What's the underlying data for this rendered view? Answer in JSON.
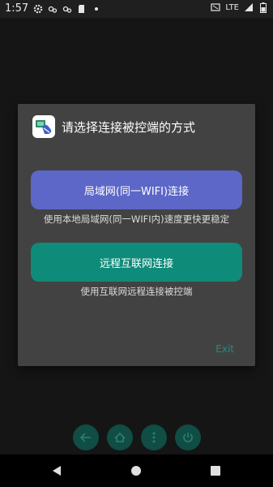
{
  "status_bar": {
    "time": "1:57",
    "network": "LTE",
    "icons": [
      "gear-icon",
      "sync-icon",
      "sync-icon",
      "sd-card-icon",
      "dot-icon",
      "cast-icon",
      "signal-icon",
      "battery-icon"
    ]
  },
  "dialog": {
    "title": "请选择连接被控端的方式",
    "app_icon": "remote-control-app-icon",
    "lan_button_label": "局域网(同一WIFI)连接",
    "lan_hint": "使用本地局域网(同一WIFI内)速度更快更稳定",
    "remote_button_label": "远程互联网连接",
    "remote_hint": "使用互联网远程连接被控端",
    "exit_label": "Exit"
  },
  "bottom_controls": [
    "back-arrow-icon",
    "home-icon",
    "more-vert-icon",
    "power-icon"
  ],
  "navbar": [
    "nav-back-icon",
    "nav-home-icon",
    "nav-recent-icon"
  ],
  "colors": {
    "lan_button": "#5c67c7",
    "remote_button": "#0f8b7a",
    "exit_text": "#1f8f80",
    "dialog_bg": "#424242"
  }
}
